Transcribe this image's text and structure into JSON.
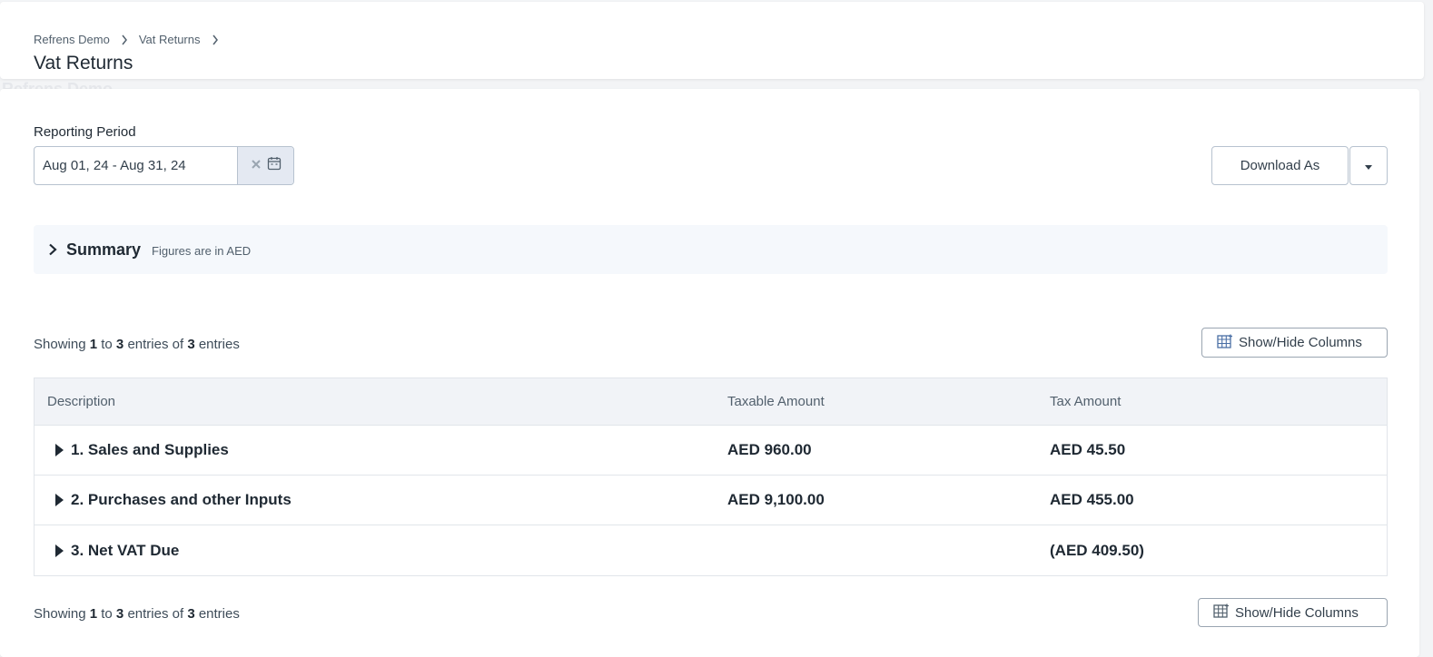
{
  "header": {
    "breadcrumb": [
      "Refrens Demo",
      "Vat Returns"
    ],
    "title": "Vat Returns",
    "ghost_text": "Refrens Demo"
  },
  "filters": {
    "reporting_period_label": "Reporting Period",
    "date_range_value": "Aug 01, 24 - Aug 31, 24",
    "download_label": "Download As"
  },
  "summary": {
    "title": "Summary",
    "subtitle": "Figures are in AED"
  },
  "pagination": {
    "prefix": "Showing",
    "from": "1",
    "to_word": "to",
    "to": "3",
    "mid": "entries of",
    "total": "3",
    "suffix": "entries"
  },
  "columns_button_label": "Show/Hide Columns",
  "table": {
    "headers": [
      "Description",
      "Taxable Amount",
      "Tax Amount"
    ],
    "rows": [
      {
        "description": "1. Sales and Supplies",
        "taxable": "AED 960.00",
        "tax": "AED 45.50"
      },
      {
        "description": "2. Purchases and other Inputs",
        "taxable": "AED 9,100.00",
        "tax": "AED 455.00"
      },
      {
        "description": "3. Net VAT Due",
        "taxable": "",
        "tax": "(AED 409.50)"
      }
    ]
  },
  "colors": {
    "accent": "#4a6fa5",
    "border": "#b7c2cf",
    "header_bg": "#f1f3f7",
    "summary_bg": "#f5f8fc"
  }
}
